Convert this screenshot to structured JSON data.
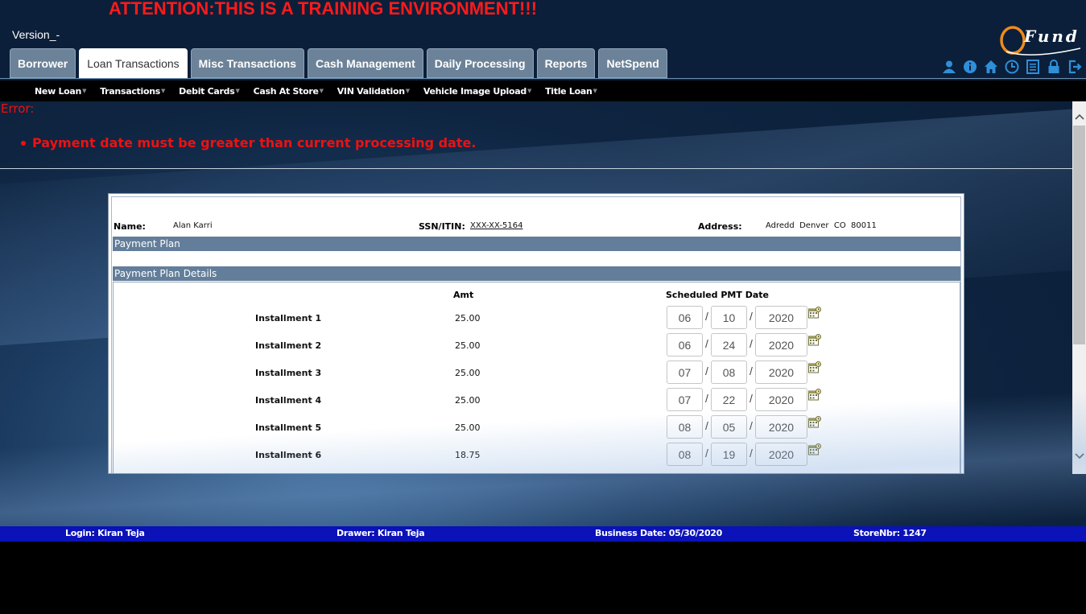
{
  "banner": "ATTENTION:THIS IS A TRAINING ENVIRONMENT!!!",
  "version": "Version_-",
  "logo_text": "Fund",
  "tabs": [
    {
      "label": "Borrower"
    },
    {
      "label": "Loan Transactions",
      "active": true
    },
    {
      "label": "Misc Transactions"
    },
    {
      "label": "Cash Management"
    },
    {
      "label": "Daily Processing"
    },
    {
      "label": "Reports"
    },
    {
      "label": "NetSpend"
    }
  ],
  "utility_icons": [
    "user-icon",
    "info-icon",
    "home-icon",
    "clock-icon",
    "list-icon",
    "lock-icon",
    "logout-icon"
  ],
  "subnav": [
    {
      "label": "New Loan"
    },
    {
      "label": "Transactions"
    },
    {
      "label": "Debit Cards"
    },
    {
      "label": "Cash At Store"
    },
    {
      "label": "VIN Validation"
    },
    {
      "label": "Vehicle Image Upload"
    },
    {
      "label": "Title Loan"
    }
  ],
  "error": {
    "title": "Error:",
    "message": "Payment date must be greater than current processing date."
  },
  "customer": {
    "name_label": "Name:",
    "name": "Alan Karri",
    "ssn_label": "SSN/ITIN:",
    "ssn": "XXX-XX-5164",
    "address_label": "Address:",
    "address": "Adredd  Denver  CO  80011"
  },
  "sections": {
    "payment_plan": "Payment Plan",
    "payment_plan_details": "Payment Plan Details"
  },
  "table": {
    "amt_header": "Amt",
    "date_header": "Scheduled PMT Date",
    "rows": [
      {
        "label": "Installment 1",
        "amt": "25.00",
        "mm": "06",
        "dd": "10",
        "yyyy": "2020"
      },
      {
        "label": "Installment 2",
        "amt": "25.00",
        "mm": "06",
        "dd": "24",
        "yyyy": "2020"
      },
      {
        "label": "Installment 3",
        "amt": "25.00",
        "mm": "07",
        "dd": "08",
        "yyyy": "2020"
      },
      {
        "label": "Installment 4",
        "amt": "25.00",
        "mm": "07",
        "dd": "22",
        "yyyy": "2020"
      },
      {
        "label": "Installment 5",
        "amt": "25.00",
        "mm": "08",
        "dd": "05",
        "yyyy": "2020"
      },
      {
        "label": "Installment 6",
        "amt": "18.75",
        "mm": "08",
        "dd": "19",
        "yyyy": "2020"
      }
    ]
  },
  "footer": {
    "login": "Login: Kiran Teja",
    "drawer": "Drawer: Kiran Teja",
    "business_date": "Business Date: 05/30/2020",
    "store": "StoreNbr: 1247"
  },
  "colors": {
    "banner": "#ff1a1a",
    "error": "#ee1111",
    "tab": "#6b8298",
    "section_bar": "#637e9a",
    "footer": "#0a12b8"
  }
}
